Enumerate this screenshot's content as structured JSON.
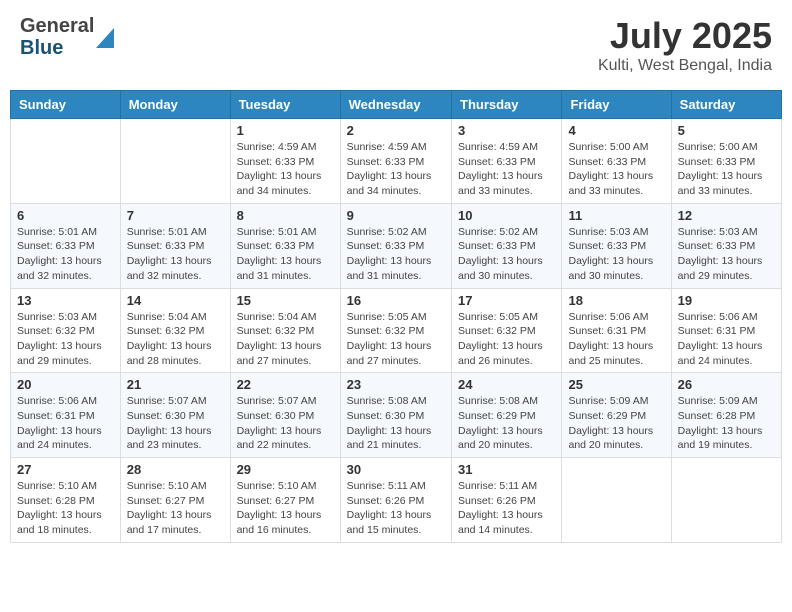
{
  "header": {
    "logo_general": "General",
    "logo_blue": "Blue",
    "month_title": "July 2025",
    "location": "Kulti, West Bengal, India"
  },
  "weekdays": [
    "Sunday",
    "Monday",
    "Tuesday",
    "Wednesday",
    "Thursday",
    "Friday",
    "Saturday"
  ],
  "weeks": [
    [
      {
        "day": "",
        "sunrise": "",
        "sunset": "",
        "daylight": ""
      },
      {
        "day": "",
        "sunrise": "",
        "sunset": "",
        "daylight": ""
      },
      {
        "day": "1",
        "sunrise": "Sunrise: 4:59 AM",
        "sunset": "Sunset: 6:33 PM",
        "daylight": "Daylight: 13 hours and 34 minutes."
      },
      {
        "day": "2",
        "sunrise": "Sunrise: 4:59 AM",
        "sunset": "Sunset: 6:33 PM",
        "daylight": "Daylight: 13 hours and 34 minutes."
      },
      {
        "day": "3",
        "sunrise": "Sunrise: 4:59 AM",
        "sunset": "Sunset: 6:33 PM",
        "daylight": "Daylight: 13 hours and 33 minutes."
      },
      {
        "day": "4",
        "sunrise": "Sunrise: 5:00 AM",
        "sunset": "Sunset: 6:33 PM",
        "daylight": "Daylight: 13 hours and 33 minutes."
      },
      {
        "day": "5",
        "sunrise": "Sunrise: 5:00 AM",
        "sunset": "Sunset: 6:33 PM",
        "daylight": "Daylight: 13 hours and 33 minutes."
      }
    ],
    [
      {
        "day": "6",
        "sunrise": "Sunrise: 5:01 AM",
        "sunset": "Sunset: 6:33 PM",
        "daylight": "Daylight: 13 hours and 32 minutes."
      },
      {
        "day": "7",
        "sunrise": "Sunrise: 5:01 AM",
        "sunset": "Sunset: 6:33 PM",
        "daylight": "Daylight: 13 hours and 32 minutes."
      },
      {
        "day": "8",
        "sunrise": "Sunrise: 5:01 AM",
        "sunset": "Sunset: 6:33 PM",
        "daylight": "Daylight: 13 hours and 31 minutes."
      },
      {
        "day": "9",
        "sunrise": "Sunrise: 5:02 AM",
        "sunset": "Sunset: 6:33 PM",
        "daylight": "Daylight: 13 hours and 31 minutes."
      },
      {
        "day": "10",
        "sunrise": "Sunrise: 5:02 AM",
        "sunset": "Sunset: 6:33 PM",
        "daylight": "Daylight: 13 hours and 30 minutes."
      },
      {
        "day": "11",
        "sunrise": "Sunrise: 5:03 AM",
        "sunset": "Sunset: 6:33 PM",
        "daylight": "Daylight: 13 hours and 30 minutes."
      },
      {
        "day": "12",
        "sunrise": "Sunrise: 5:03 AM",
        "sunset": "Sunset: 6:33 PM",
        "daylight": "Daylight: 13 hours and 29 minutes."
      }
    ],
    [
      {
        "day": "13",
        "sunrise": "Sunrise: 5:03 AM",
        "sunset": "Sunset: 6:32 PM",
        "daylight": "Daylight: 13 hours and 29 minutes."
      },
      {
        "day": "14",
        "sunrise": "Sunrise: 5:04 AM",
        "sunset": "Sunset: 6:32 PM",
        "daylight": "Daylight: 13 hours and 28 minutes."
      },
      {
        "day": "15",
        "sunrise": "Sunrise: 5:04 AM",
        "sunset": "Sunset: 6:32 PM",
        "daylight": "Daylight: 13 hours and 27 minutes."
      },
      {
        "day": "16",
        "sunrise": "Sunrise: 5:05 AM",
        "sunset": "Sunset: 6:32 PM",
        "daylight": "Daylight: 13 hours and 27 minutes."
      },
      {
        "day": "17",
        "sunrise": "Sunrise: 5:05 AM",
        "sunset": "Sunset: 6:32 PM",
        "daylight": "Daylight: 13 hours and 26 minutes."
      },
      {
        "day": "18",
        "sunrise": "Sunrise: 5:06 AM",
        "sunset": "Sunset: 6:31 PM",
        "daylight": "Daylight: 13 hours and 25 minutes."
      },
      {
        "day": "19",
        "sunrise": "Sunrise: 5:06 AM",
        "sunset": "Sunset: 6:31 PM",
        "daylight": "Daylight: 13 hours and 24 minutes."
      }
    ],
    [
      {
        "day": "20",
        "sunrise": "Sunrise: 5:06 AM",
        "sunset": "Sunset: 6:31 PM",
        "daylight": "Daylight: 13 hours and 24 minutes."
      },
      {
        "day": "21",
        "sunrise": "Sunrise: 5:07 AM",
        "sunset": "Sunset: 6:30 PM",
        "daylight": "Daylight: 13 hours and 23 minutes."
      },
      {
        "day": "22",
        "sunrise": "Sunrise: 5:07 AM",
        "sunset": "Sunset: 6:30 PM",
        "daylight": "Daylight: 13 hours and 22 minutes."
      },
      {
        "day": "23",
        "sunrise": "Sunrise: 5:08 AM",
        "sunset": "Sunset: 6:30 PM",
        "daylight": "Daylight: 13 hours and 21 minutes."
      },
      {
        "day": "24",
        "sunrise": "Sunrise: 5:08 AM",
        "sunset": "Sunset: 6:29 PM",
        "daylight": "Daylight: 13 hours and 20 minutes."
      },
      {
        "day": "25",
        "sunrise": "Sunrise: 5:09 AM",
        "sunset": "Sunset: 6:29 PM",
        "daylight": "Daylight: 13 hours and 20 minutes."
      },
      {
        "day": "26",
        "sunrise": "Sunrise: 5:09 AM",
        "sunset": "Sunset: 6:28 PM",
        "daylight": "Daylight: 13 hours and 19 minutes."
      }
    ],
    [
      {
        "day": "27",
        "sunrise": "Sunrise: 5:10 AM",
        "sunset": "Sunset: 6:28 PM",
        "daylight": "Daylight: 13 hours and 18 minutes."
      },
      {
        "day": "28",
        "sunrise": "Sunrise: 5:10 AM",
        "sunset": "Sunset: 6:27 PM",
        "daylight": "Daylight: 13 hours and 17 minutes."
      },
      {
        "day": "29",
        "sunrise": "Sunrise: 5:10 AM",
        "sunset": "Sunset: 6:27 PM",
        "daylight": "Daylight: 13 hours and 16 minutes."
      },
      {
        "day": "30",
        "sunrise": "Sunrise: 5:11 AM",
        "sunset": "Sunset: 6:26 PM",
        "daylight": "Daylight: 13 hours and 15 minutes."
      },
      {
        "day": "31",
        "sunrise": "Sunrise: 5:11 AM",
        "sunset": "Sunset: 6:26 PM",
        "daylight": "Daylight: 13 hours and 14 minutes."
      },
      {
        "day": "",
        "sunrise": "",
        "sunset": "",
        "daylight": ""
      },
      {
        "day": "",
        "sunrise": "",
        "sunset": "",
        "daylight": ""
      }
    ]
  ]
}
